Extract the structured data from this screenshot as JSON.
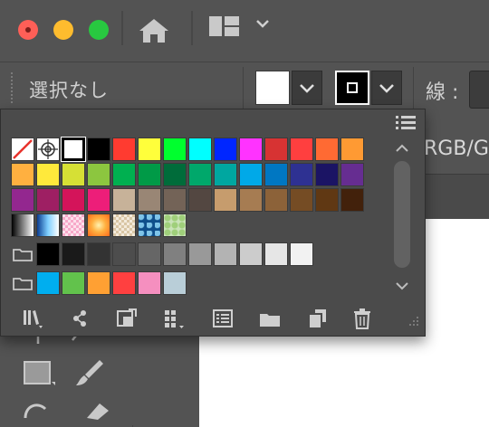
{
  "titlebar": {
    "home_icon": "home-icon",
    "layout_icon": "workspace-layout-icon"
  },
  "control_bar": {
    "selection_text": "選択なし",
    "fill_color": "#ffffff",
    "stroke_color": "#000000",
    "stroke_label": "線 :",
    "color_mode": "RGB/G"
  },
  "swatches_panel": {
    "menu_icon": "list-view-icon",
    "rows": [
      [
        "none",
        "registration",
        "#ffffff",
        "#000000",
        "#ff3b30",
        "#ffff3b",
        "#00ff2e",
        "#00ffff",
        "#0026ff",
        "#ff33ff",
        "#d73333",
        "#ff3f3f",
        "#ff6a33",
        "#ff9a33"
      ],
      [
        "#ffb040",
        "#ffe93b",
        "#d6e035",
        "#8cc63f",
        "#00b050",
        "#009a47",
        "#006c3a",
        "#00a86b",
        "#00a7a0",
        "#00a9e8",
        "#0077c2",
        "#2e3192",
        "#1b1464",
        "#662d91"
      ],
      [
        "#93278f",
        "#9e1f63",
        "#d4145a",
        "#ed1e79",
        "#c7b299",
        "#998675",
        "#736357",
        "#534741",
        "#c69c6d",
        "#a67c52",
        "#8c6239",
        "#754c24",
        "#603813",
        "#42210b"
      ],
      [
        "gradient-bw",
        "gradient-blue",
        "pattern-pink",
        "gradient-orange",
        "pattern-check",
        "pattern-blue-floral",
        "pattern-green-floral"
      ]
    ],
    "grays": [
      "#000000",
      "#1a1a1a",
      "#333333",
      "#4d4d4d",
      "#666666",
      "#808080",
      "#999999",
      "#b3b3b3",
      "#cccccc",
      "#e6e6e6",
      "#f2f2f2"
    ],
    "group2": [
      "#00aeef",
      "#62c24c",
      "#ffa033",
      "#ff4040",
      "#f58fbf",
      "#b9ced8"
    ],
    "footer_icons": [
      "swatch-libraries-icon",
      "show-kinds-icon",
      "place-swatch-icon",
      "swatch-options-icon",
      "color-group-icon",
      "new-group-folder-icon",
      "new-swatch-icon",
      "delete-icon"
    ]
  }
}
